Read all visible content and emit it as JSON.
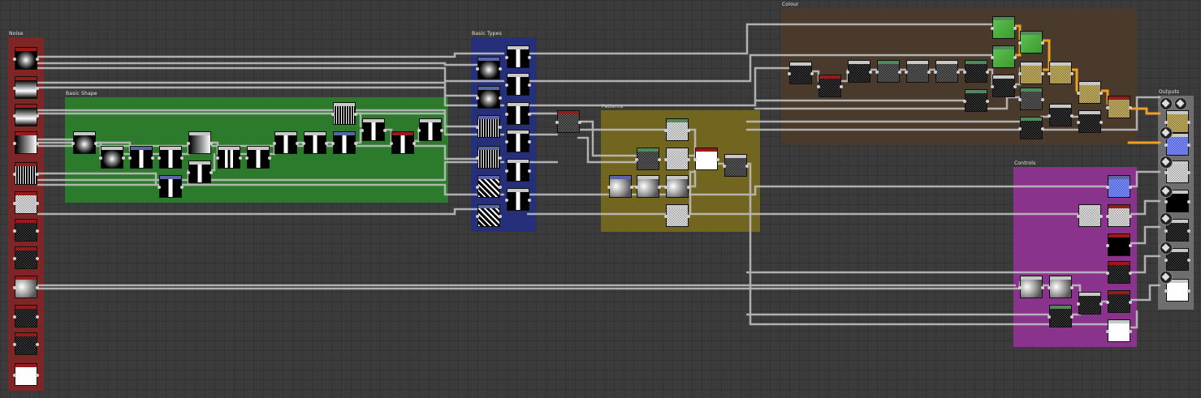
{
  "frames": [
    {
      "id": "noise",
      "title": "Noise",
      "color": "#8a2a2a"
    },
    {
      "id": "basic-shape",
      "title": "Basic Shape",
      "color": "#2f7d2f"
    },
    {
      "id": "basic-types",
      "title": "Basic Types",
      "color": "#2d3a8c"
    },
    {
      "id": "patterns",
      "title": "Patterns",
      "color": "#7a6b22"
    },
    {
      "id": "colour",
      "title": "Colour",
      "color": "#4a3a2c"
    },
    {
      "id": "controls",
      "title": "Controls",
      "color": "#8a3a8c"
    },
    {
      "id": "outputs",
      "title": "Outputs",
      "color": "#707070"
    }
  ],
  "colors": {
    "background": "#3b3b3b",
    "wire": "#bdbdbd",
    "wire_highlight": "#f0a020",
    "header_gray": "#c8c8c8",
    "header_red": "#9a1a1a",
    "header_blue": "#5a64a8",
    "header_green": "#4f8a5a"
  },
  "textures": [
    "radial",
    "gradient",
    "stripes",
    "noise",
    "blocks",
    "bars",
    "green",
    "sand",
    "blue",
    "white",
    "flat"
  ],
  "icons": [
    "node-thumbnail-icon",
    "output-cube-icon",
    "port-dot-icon"
  ]
}
